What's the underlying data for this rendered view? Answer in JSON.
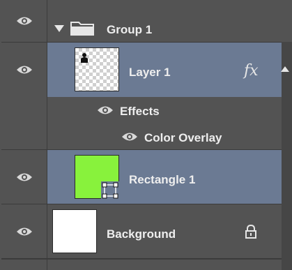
{
  "layers": [
    {
      "name": "Group 1"
    },
    {
      "name": "Layer 1",
      "fx": "fx"
    },
    {
      "name": "Effects"
    },
    {
      "name": "Color Overlay"
    },
    {
      "name": "Rectangle 1"
    },
    {
      "name": "Background"
    }
  ],
  "colors": {
    "panel_bg": "#535353",
    "selected_bg": "#6b7a93",
    "rectangle_fill": "#88f23c"
  },
  "icons": {
    "visibility": "eye-icon",
    "group": "folder-icon",
    "expand": "triangle-down-icon",
    "lock": "lock-icon",
    "shape": "shape-vector-icon",
    "fx": "fx-icon"
  }
}
